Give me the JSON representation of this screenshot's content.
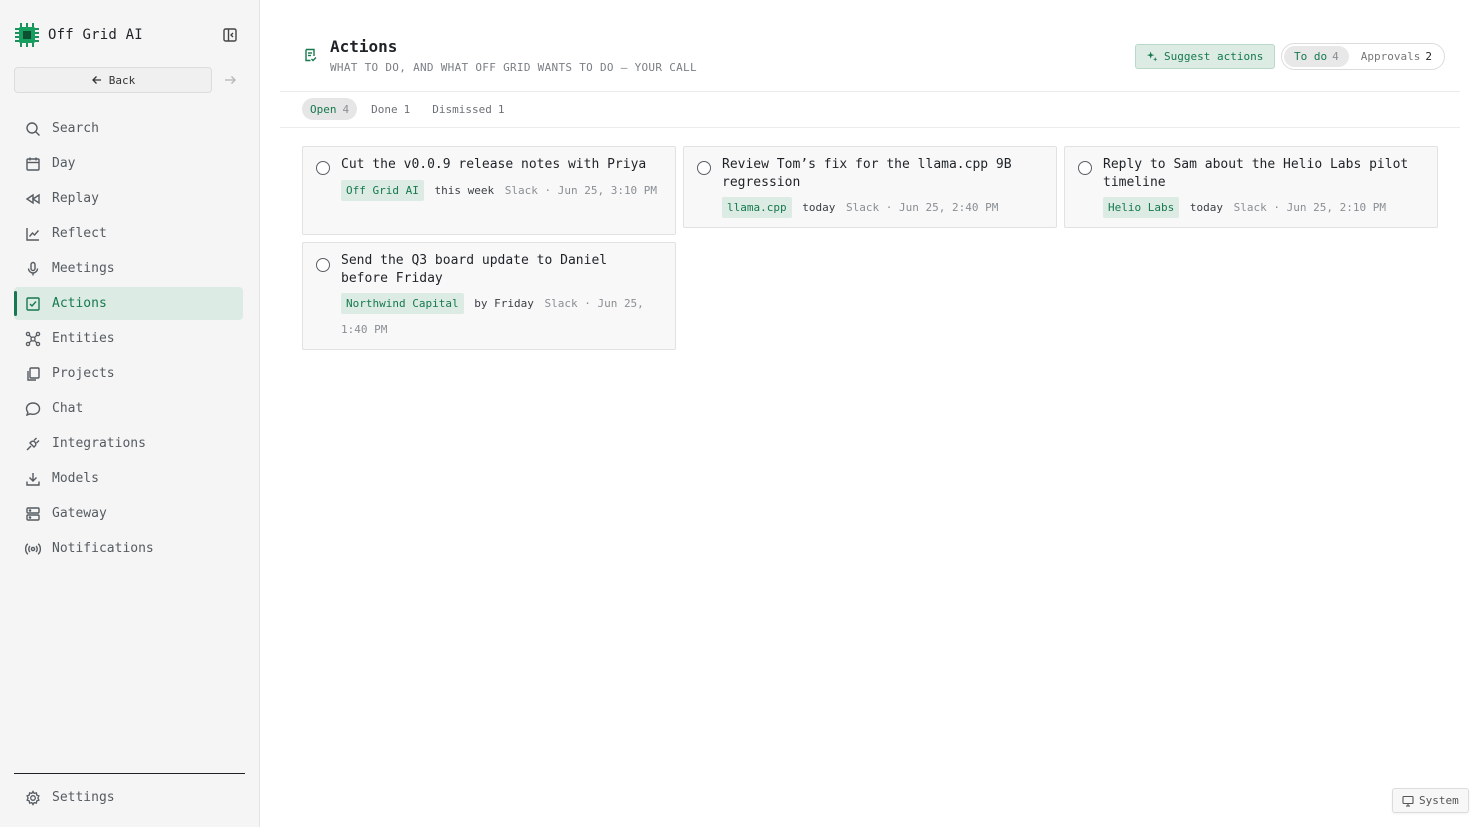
{
  "app": {
    "name": "Off Grid AI",
    "accent": "#16794f"
  },
  "sidebar": {
    "back_label": "Back",
    "items": [
      {
        "label": "Search",
        "icon": "search-icon"
      },
      {
        "label": "Day",
        "icon": "calendar-icon"
      },
      {
        "label": "Replay",
        "icon": "rewind-icon"
      },
      {
        "label": "Reflect",
        "icon": "trend-icon"
      },
      {
        "label": "Meetings",
        "icon": "microphone-icon"
      },
      {
        "label": "Actions",
        "icon": "checkbox-icon",
        "active": true
      },
      {
        "label": "Entities",
        "icon": "graph-icon"
      },
      {
        "label": "Projects",
        "icon": "files-icon"
      },
      {
        "label": "Chat",
        "icon": "chat-icon"
      },
      {
        "label": "Integrations",
        "icon": "plug-icon"
      },
      {
        "label": "Models",
        "icon": "download-icon"
      },
      {
        "label": "Gateway",
        "icon": "server-icon"
      },
      {
        "label": "Notifications",
        "icon": "broadcast-icon"
      }
    ],
    "settings_label": "Settings"
  },
  "header": {
    "title": "Actions",
    "subtitle": "WHAT TO DO, AND WHAT OFF GRID WANTS TO DO — YOUR CALL",
    "suggest_label": "Suggest actions",
    "modes": [
      {
        "label": "To do",
        "count": "4",
        "active": true
      },
      {
        "label": "Approvals",
        "count": "2",
        "active": false
      }
    ]
  },
  "tabs": [
    {
      "label": "Open",
      "count": "4",
      "active": true
    },
    {
      "label": "Done",
      "count": "1",
      "active": false
    },
    {
      "label": "Dismissed",
      "count": "1",
      "active": false
    }
  ],
  "cards": [
    {
      "title": "Cut the v0.0.9 release notes with Priya",
      "tag": "Off Grid AI",
      "due": "this week",
      "source": "Slack",
      "time": "· Jun 25, 3:10 PM"
    },
    {
      "title": "Review Tom’s fix for the llama.cpp 9B regression",
      "tag": "llama.cpp",
      "due": "today",
      "source": "Slack",
      "time": "· Jun 25, 2:40 PM"
    },
    {
      "title": "Reply to Sam about the Helio Labs pilot timeline",
      "tag": "Helio Labs",
      "due": "today",
      "source": "Slack",
      "time": "· Jun 25, 2:10 PM"
    },
    {
      "title": "Send the Q3 board update to Daniel before Friday",
      "tag": "Northwind Capital",
      "due": "by Friday",
      "source": "Slack",
      "time": "· Jun 25, 1:40 PM"
    }
  ],
  "footer": {
    "system_label": "System"
  }
}
